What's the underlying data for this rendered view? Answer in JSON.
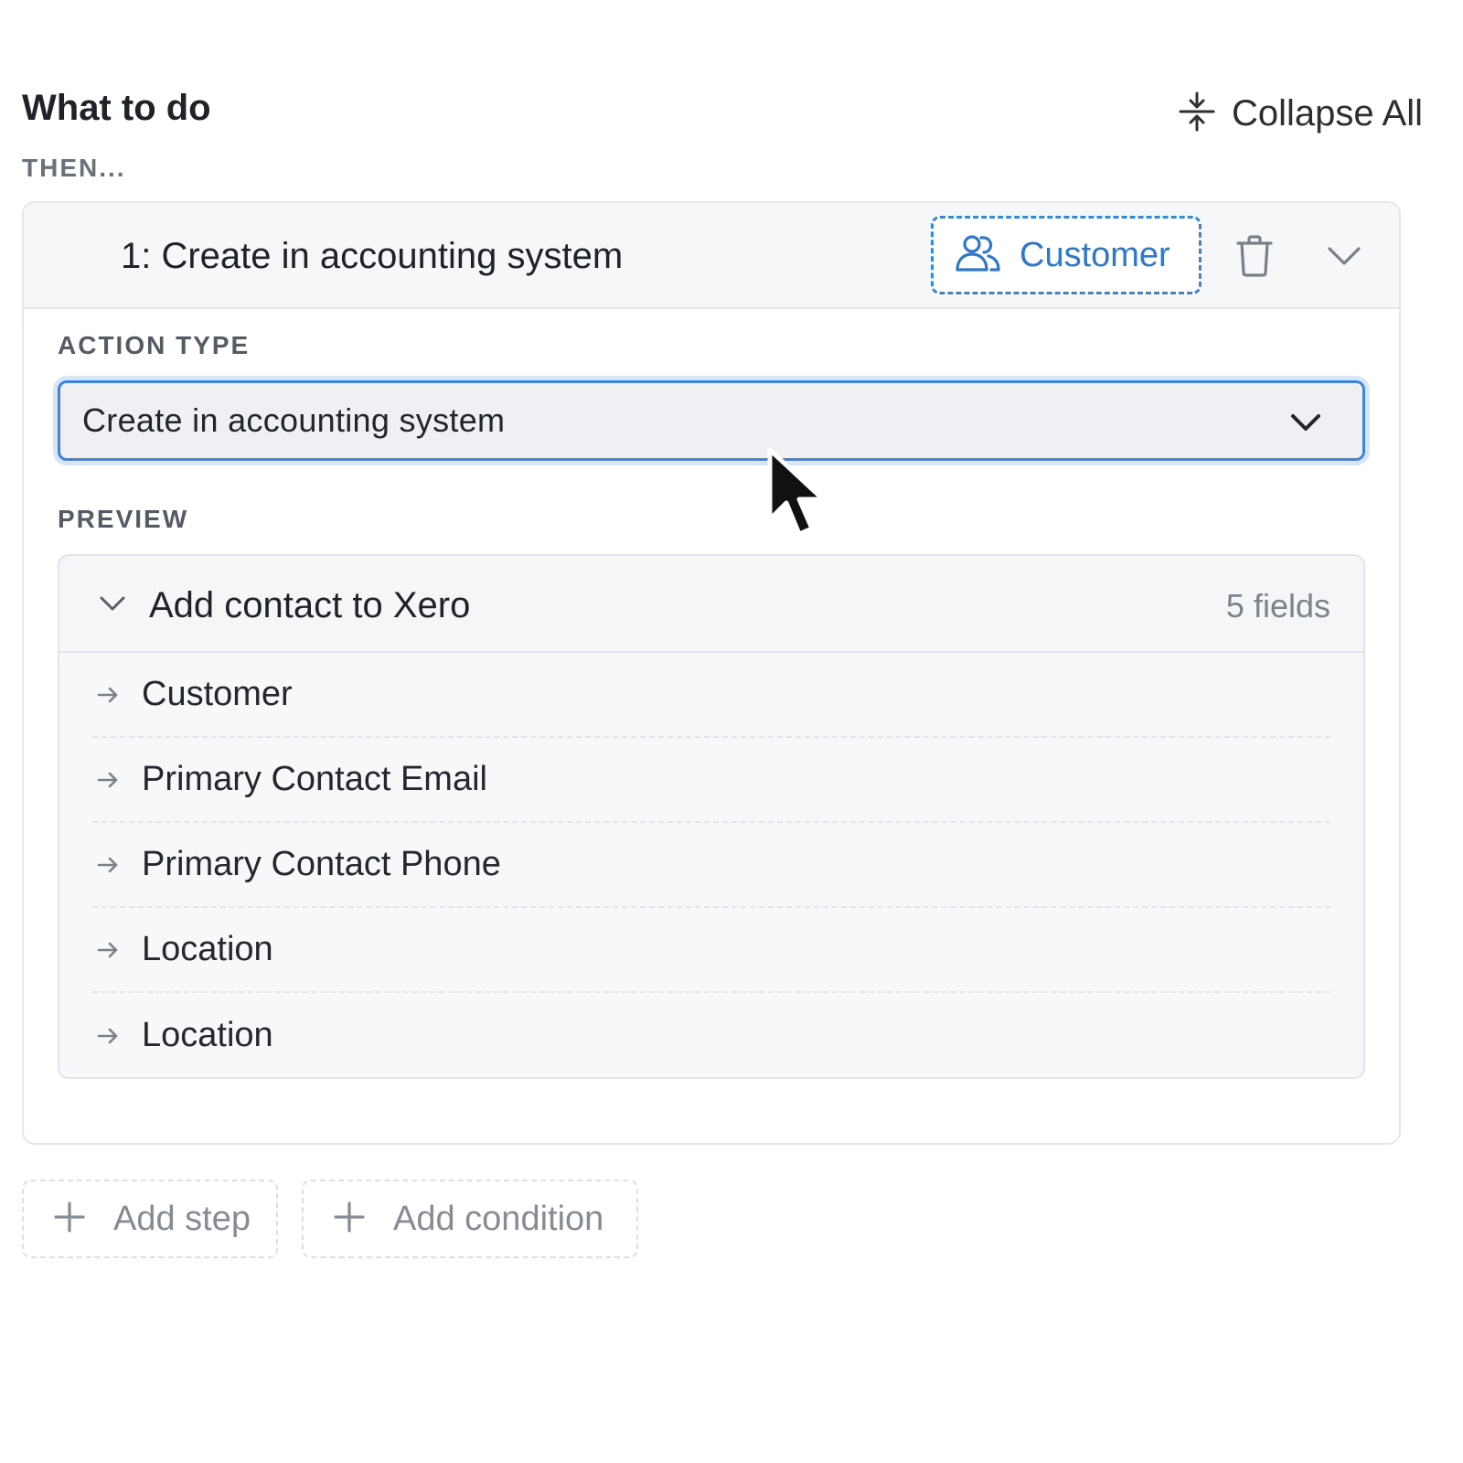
{
  "header": {
    "title": "What to do",
    "collapse_all_label": "Collapse All"
  },
  "then_label": "THEN...",
  "step": {
    "title": "1: Create in accounting system",
    "entity_chip_label": "Customer",
    "action_type_label": "ACTION TYPE",
    "action_type_value": "Create in accounting system",
    "preview_label": "PREVIEW",
    "preview": {
      "title": "Add contact to Xero",
      "field_count": "5 fields",
      "fields": [
        {
          "label": "Customer"
        },
        {
          "label": "Primary Contact Email"
        },
        {
          "label": "Primary Contact Phone"
        },
        {
          "label": "Location"
        },
        {
          "label": "Location"
        }
      ]
    }
  },
  "footer": {
    "add_step_label": "Add step",
    "add_condition_label": "Add condition"
  },
  "colors": {
    "accent": "#3e84d9",
    "chip_text": "#2f78c9",
    "muted_text": "#868c93",
    "border": "#e4e6e9"
  },
  "icons": [
    "collapse-icon",
    "users-icon",
    "trash-icon",
    "chevron-down-icon",
    "arrow-right-icon",
    "plus-icon",
    "mouse-cursor"
  ]
}
